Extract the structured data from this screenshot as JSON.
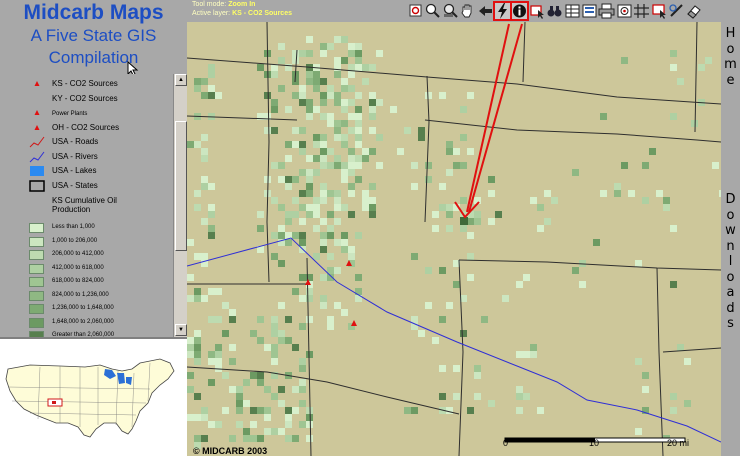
{
  "app": {
    "title": "Midcarb Maps",
    "subtitle_line1": "A Five State GIS",
    "subtitle_line2": "Compilation"
  },
  "status": {
    "tool_mode_label": "Tool mode:",
    "tool_mode_value": "Zoom In",
    "active_layer_label": "Active layer:",
    "active_layer_value": "KS - CO2 Sources"
  },
  "toolbar": {
    "tools": [
      {
        "name": "zoom-to-full-icon",
        "active": false
      },
      {
        "name": "zoom-in-icon",
        "active": false
      },
      {
        "name": "zoom-out-icon",
        "active": false
      },
      {
        "name": "pan-hand-icon",
        "active": false
      },
      {
        "name": "back-arrow-icon",
        "active": false
      },
      {
        "name": "hyperlink-bolt-icon",
        "active": true
      },
      {
        "name": "identify-info-icon",
        "active": true
      },
      {
        "name": "select-icon",
        "active": false
      },
      {
        "name": "find-binoculars-icon",
        "active": false
      },
      {
        "name": "query-table-icon",
        "active": false
      },
      {
        "name": "layers-icon",
        "active": false
      },
      {
        "name": "print-icon",
        "active": false
      },
      {
        "name": "buffer-icon",
        "active": false
      },
      {
        "name": "grid-icon",
        "active": false
      },
      {
        "name": "select-box-icon",
        "active": false
      },
      {
        "name": "measure-icon",
        "active": false
      },
      {
        "name": "clear-eraser-icon",
        "active": false
      }
    ],
    "accent_color": "#e01010"
  },
  "legend": {
    "items": [
      {
        "label": "KS - CO2 Sources",
        "symbol": "red-triangle-icon"
      },
      {
        "label": "KY - CO2 Sources",
        "symbol": "none"
      },
      {
        "label": "Power Plants",
        "symbol": "red-triangle-icon",
        "small": true
      },
      {
        "label": "OH - CO2 Sources",
        "symbol": "red-triangle-icon"
      },
      {
        "label": "USA - Roads",
        "symbol": "road-line-icon"
      },
      {
        "label": "USA - Rivers",
        "symbol": "river-line-icon"
      },
      {
        "label": "USA - Lakes",
        "symbol": "lake-swatch-icon"
      },
      {
        "label": "USA - States",
        "symbol": "state-outline-icon"
      }
    ],
    "ramp_title_line1": "KS Cumulative Oil",
    "ramp_title_line2": "Production",
    "ramp": [
      {
        "label": "Less than 1,000",
        "color": "#d8f0cc"
      },
      {
        "label": "1,000 to 206,000",
        "color": "#cce6c0"
      },
      {
        "label": "206,000 to 412,000",
        "color": "#bddbb0"
      },
      {
        "label": "412,000 to 618,000",
        "color": "#aed0a2"
      },
      {
        "label": "618,000 to 824,000",
        "color": "#9fc592"
      },
      {
        "label": "824,000 to 1,236,000",
        "color": "#8fb883"
      },
      {
        "label": "1,236,000 to 1,648,000",
        "color": "#7eaa73"
      },
      {
        "label": "1,648,000 to 2,060,000",
        "color": "#6c9a62"
      },
      {
        "label": "Greater than 2,060,000",
        "color": "#577f4e"
      }
    ]
  },
  "map": {
    "copyright": "© MIDCARB 2003",
    "scale_labels": [
      "0",
      "10",
      "20 mi"
    ]
  },
  "nav": {
    "home": "Home",
    "downloads": "Downloads"
  }
}
